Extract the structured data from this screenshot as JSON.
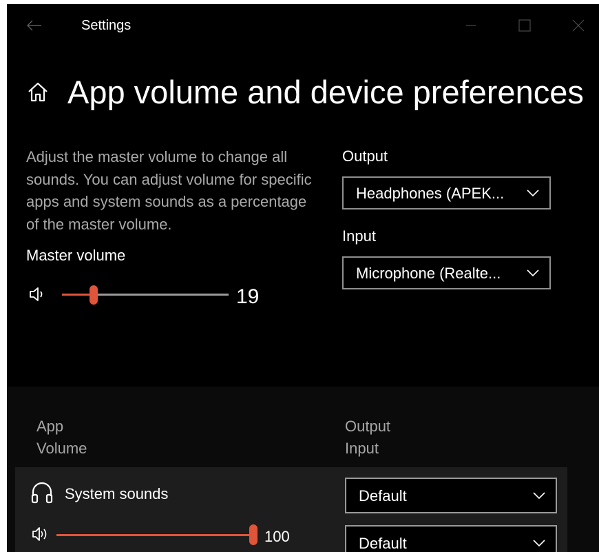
{
  "window": {
    "title": "Settings",
    "colors": {
      "background": "#000000",
      "accent": "#e0553a",
      "row_background": "#1d1d1d"
    }
  },
  "header": {
    "title": "App volume and device preferences",
    "icon": "home-icon"
  },
  "master": {
    "description": "Adjust the master volume to change all sounds. You can adjust volume for specific apps and system sounds as a percentage of the master volume.",
    "label": "Master volume",
    "value": "19",
    "level_percent": 19,
    "icon": "speaker-icon"
  },
  "output": {
    "label": "Output",
    "selected": "Headphones (APEK..."
  },
  "input": {
    "label": "Input",
    "selected": "Microphone (Realte..."
  },
  "table": {
    "headers": {
      "app": "App",
      "volume": "Volume",
      "output": "Output",
      "input": "Input"
    },
    "rows": [
      {
        "name": "System sounds",
        "icon": "headphones-icon",
        "volume_icon": "speaker-icon",
        "volume": "100",
        "level_percent": 100,
        "output": "Default",
        "input": "Default"
      }
    ]
  }
}
